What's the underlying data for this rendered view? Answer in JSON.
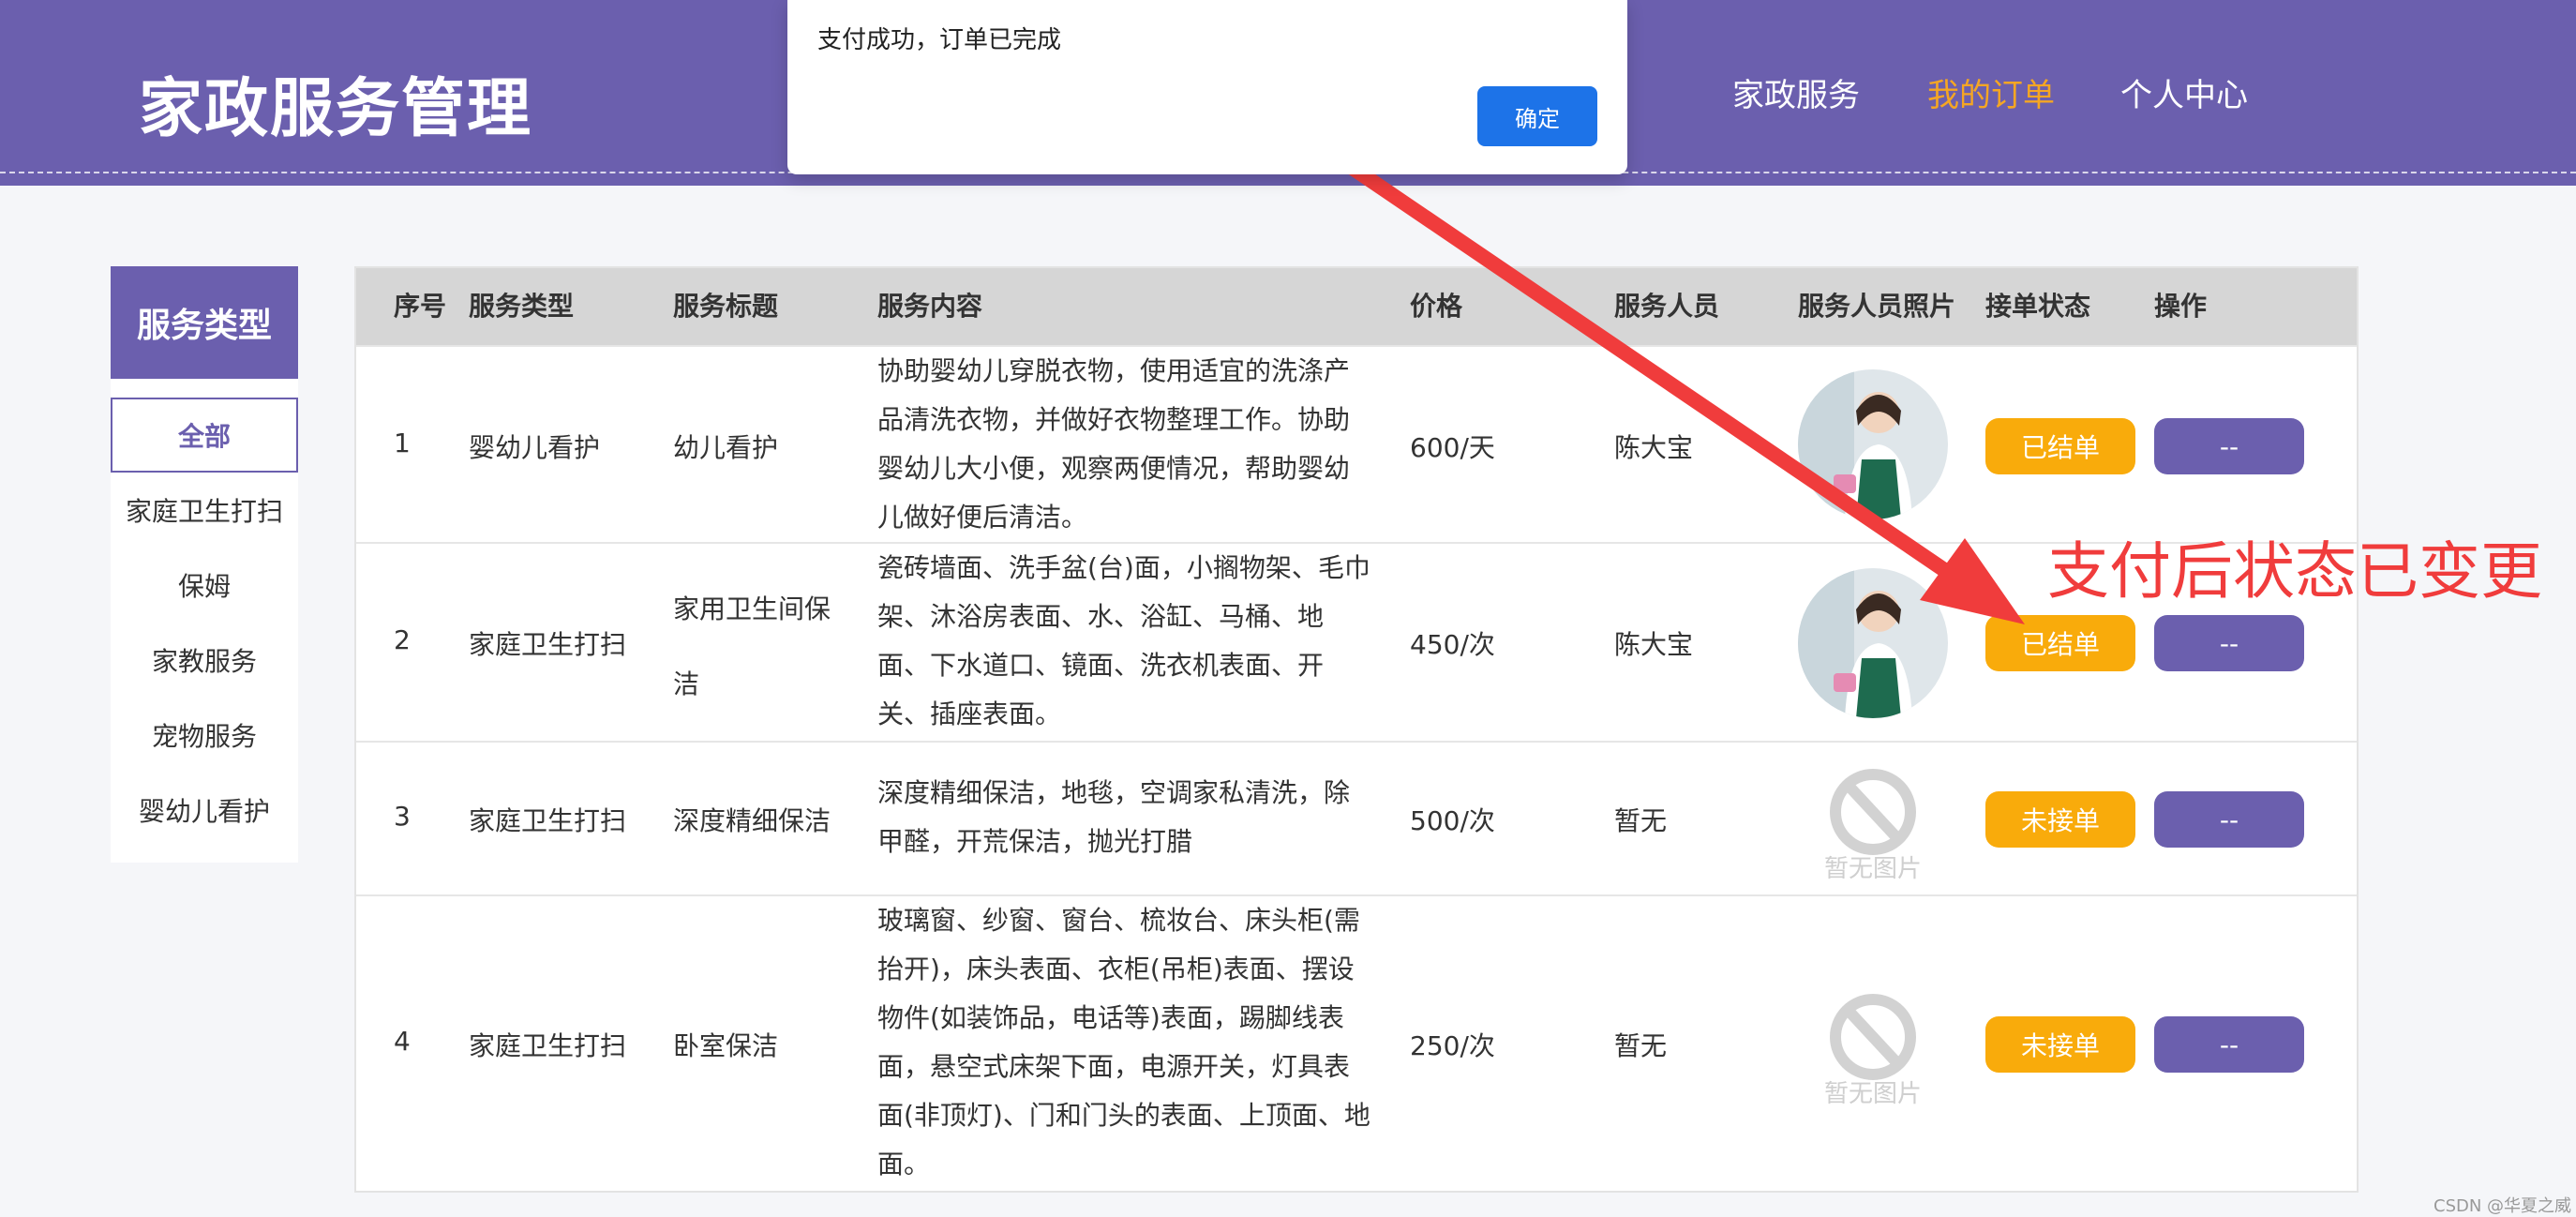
{
  "header": {
    "brand": "家政服务管理",
    "nav": [
      "家政服务",
      "我的订单",
      "个人中心"
    ],
    "active_nav": "我的订单"
  },
  "dialog": {
    "message": "支付成功，订单已完成",
    "ok_label": "确定"
  },
  "sidebar": {
    "title": "服务类型",
    "items": [
      "全部",
      "家庭卫生打扫",
      "保姆",
      "家教服务",
      "宠物服务",
      "婴幼儿看护"
    ],
    "active": "全部"
  },
  "table": {
    "headers": [
      "序号",
      "服务类型",
      "服务标题",
      "服务内容",
      "价格",
      "服务人员",
      "服务人员照片",
      "接单状态",
      "操作"
    ],
    "rows": [
      {
        "index": "1",
        "type": "婴幼儿看护",
        "title": "幼儿看护",
        "content": "协助婴幼儿穿脱衣物，使用适宜的洗涤产品清洗衣物，并做好衣物整理工作。协助婴幼儿大小便，观察两便情况，帮助婴幼儿做好便后清洁。",
        "price": "600/天",
        "staff": "陈大宝",
        "photo": "staff-photo",
        "status": "已结单",
        "op": "--"
      },
      {
        "index": "2",
        "type": "家庭卫生打扫",
        "title": "家用卫生间保洁",
        "content": "瓷砖墙面、洗手盆(台)面，小搁物架、毛巾架、沐浴房表面、水、浴缸、马桶、地面、下水道口、镜面、洗衣机表面、开关、插座表面。",
        "price": "450/次",
        "staff": "陈大宝",
        "photo": "staff-photo",
        "status": "已结单",
        "op": "--"
      },
      {
        "index": "3",
        "type": "家庭卫生打扫",
        "title": "深度精细保洁",
        "content": "深度精细保洁，地毯，空调家私清洗，除甲醛，开荒保洁，抛光打腊",
        "price": "500/次",
        "staff": "暂无",
        "photo": "暂无图片",
        "status": "未接单",
        "op": "--"
      },
      {
        "index": "4",
        "type": "家庭卫生打扫",
        "title": "卧室保洁",
        "content": "玻璃窗、纱窗、窗台、梳妆台、床头柜(需抬开)，床头表面、衣柜(吊柜)表面、摆设物件(如装饰品，电话等)表面，踢脚线表面，悬空式床架下面，电源开关，灯具表面(非顶灯)、门和门头的表面、上顶面、地面。",
        "price": "250/次",
        "staff": "暂无",
        "photo": "暂无图片",
        "status": "未接单",
        "op": "--"
      }
    ]
  },
  "annotation": {
    "text": "支付后状态已变更",
    "color": "#f03c3c"
  },
  "watermark": "CSDN @华夏之威",
  "colors": {
    "brand_purple": "#6b5fae",
    "active_nav": "#f5a623",
    "status_orange": "#f9ab0b",
    "dialog_blue": "#1d73e8"
  }
}
